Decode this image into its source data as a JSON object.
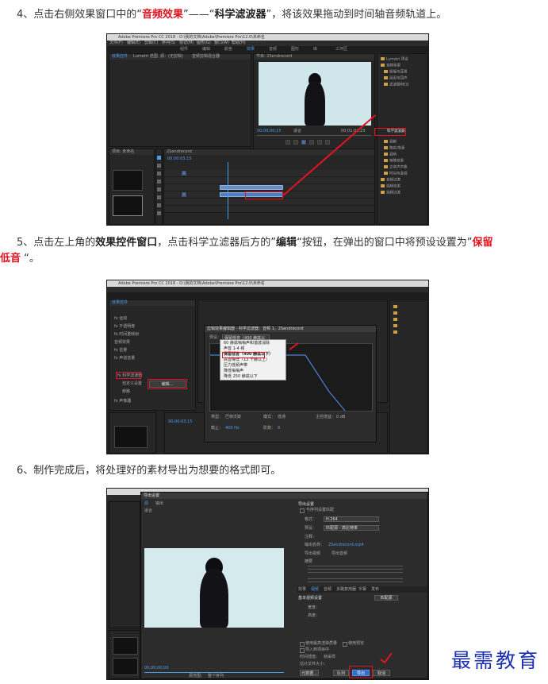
{
  "steps": {
    "s4": {
      "prefix": "4、点击右侧效果窗口中的“",
      "red": "音频效果",
      "mid": "”——“",
      "bold": "科学滤波器",
      "suffix": "”，将该效果拖动到时间轴音频轨道上。"
    },
    "s5": {
      "line1_a": "5、点击左上角的",
      "line1_b": "效果控件窗口",
      "line1_c": "，点击科学立滤器后方的”",
      "line1_d": "编辑",
      "line1_e": "“按钮，在弹出的窗口中将预设设置为”",
      "line1_f": "保留",
      "line2_red": "低音",
      "line2_end": " “。"
    },
    "s6": {
      "text": "6、制作完成后，将处理好的素材导出为想要的格式即可。"
    }
  },
  "shot1": {
    "title": "Adobe Premiere Pro CC 2018 - D:\\我的文档\\Adobe\\Premiere Pro\\12.0\\未命名",
    "menu": [
      "文件(F)",
      "编辑(E)",
      "剪辑(C)",
      "序列(S)",
      "标记(M)",
      "图形(G)",
      "窗口(W)",
      "帮助(H)"
    ],
    "workspaces": [
      "组件",
      "编辑",
      "颜色",
      "效果",
      "音频",
      "图形",
      "库",
      "工作区"
    ],
    "active_ws": "效果",
    "left_panel_tabs": [
      "效果控件",
      "Lumetri 范围",
      "源：(无剪辑)",
      "音频剪辑混合器"
    ],
    "program_tab": "节目: 2Sendrecord",
    "timecode_left": "00;00;00;15",
    "timecode_right": "00;01;02;23",
    "fit": "适合",
    "timeline_tab": "2Sendrecord",
    "timeline_tc": "00:00:03:15",
    "project_tab": "项目: 未命名",
    "effects_tree": [
      "Lumetri 预设",
      "音频效果",
      "振幅与压限",
      "延迟与回声",
      "滤波器和EQ",
      "科学滤波器",
      "调制",
      "降杂/恢复",
      "混响",
      "特殊效果",
      "立体声声像",
      "时间与变调",
      "音频过渡",
      "视频效果",
      "视频过渡"
    ],
    "highlight_item": "科学滤波器"
  },
  "shot2": {
    "title": "Adobe Premiere Pro CC 2018 - D:\\我的文档\\Adobe\\Premiere Pro\\12.0\\未命名",
    "ec_tab": "效果控件",
    "ec_rows": [
      "fx 运动",
      "fx 不透明度",
      "fx 时间重映射",
      "音频效果",
      "fx 音量",
      "fx 声道音量",
      "fx 科学滤波器",
      "自定义设置",
      "旁路",
      "fx 声像器"
    ],
    "edit_button": "编辑...",
    "dialog_title": "剪辑效果编辑器 - 科学滤波器：音频 1，2Sendrecord",
    "preset_label": "预设：",
    "preset_value": "保留低音（400 赫兹以下）",
    "preset_options": [
      "60 赫兹嗡嗡声和谐波消除",
      "声音 1-4 频",
      "保留低音（400 赫兹以下）",
      "高音降低（13 千赫以上）",
      "压力低频声带",
      "降低嗡嗡声",
      "降低 250 赫兹以下"
    ],
    "type_label": "类型：",
    "type_value": "巴特沃斯",
    "mode_label": "模式：",
    "mode_value": "低通",
    "gain_label": "主控增益：",
    "gain_value": "0 dB",
    "cutoff_label": "截止：",
    "cutoff_value": "400 Hz",
    "order_label": "阶数：",
    "order_value": "8",
    "timecode": "00:00:03:15"
  },
  "shot3": {
    "dialog_title": "导出设置",
    "source_tab": "源",
    "output_tab": "输出",
    "range_label": "源范围：",
    "range_value": "整个序列",
    "export_settings": "导出设置",
    "match_seq": "与序列设置匹配",
    "format_label": "格式：",
    "format_value": "H.264",
    "preset_label": "预设：",
    "preset_value": "匹配源 - 高比特率",
    "comments_label": "注释：",
    "output_name_label": "输出名称：",
    "output_name_value": "2Sendrecord.mp4",
    "export_video": "导出视频",
    "export_audio": "导出音频",
    "summary_label": "摘要",
    "tabs": [
      "效果",
      "视频",
      "音频",
      "多路复用器",
      "字幕",
      "发布"
    ],
    "basic_video": "基本视频设置",
    "match_source": "匹配源",
    "width_label": "宽度：",
    "height_label": "高度：",
    "use_max": "使用最高渲染质量",
    "use_previews": "使用预览",
    "import_project": "导入到项目中",
    "time_interp": "时间插值：",
    "time_interp_value": "帧采样",
    "est_size": "估计文件大小：",
    "metadata_btn": "元数据...",
    "queue_btn": "队列",
    "export_btn": "导出",
    "cancel_btn": "取消",
    "timecode": "00;00;00;00",
    "fit": "适合",
    "source_range_bottom": "源范围：",
    "source_range_value": "整个序列"
  },
  "watermark": "最需教育",
  "colors": {
    "accent_red": "#e0141e",
    "premiere_blue": "#4c9be8",
    "watermark": "#1a2fb5"
  }
}
